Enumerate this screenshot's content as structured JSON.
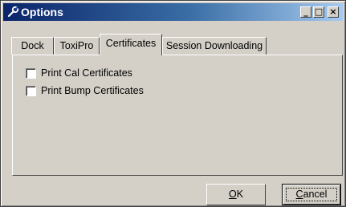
{
  "window": {
    "title": "Options",
    "title_icon": "wrench-icon",
    "controls": {
      "minimize": "_",
      "maximize": "□",
      "close": "×"
    }
  },
  "tabs": [
    {
      "label": "Dock",
      "active": false
    },
    {
      "label": "ToxiPro",
      "active": false
    },
    {
      "label": "Certificates",
      "active": true
    },
    {
      "label": "Session Downloading",
      "active": false
    }
  ],
  "certificates": {
    "options": [
      {
        "label": "Print Cal Certificates",
        "checked": false
      },
      {
        "label": "Print Bump Certificates",
        "checked": false
      }
    ]
  },
  "buttons": {
    "ok": {
      "mnemonic": "O",
      "rest": "K"
    },
    "cancel": {
      "mnemonic": "C",
      "rest": "ancel"
    }
  }
}
